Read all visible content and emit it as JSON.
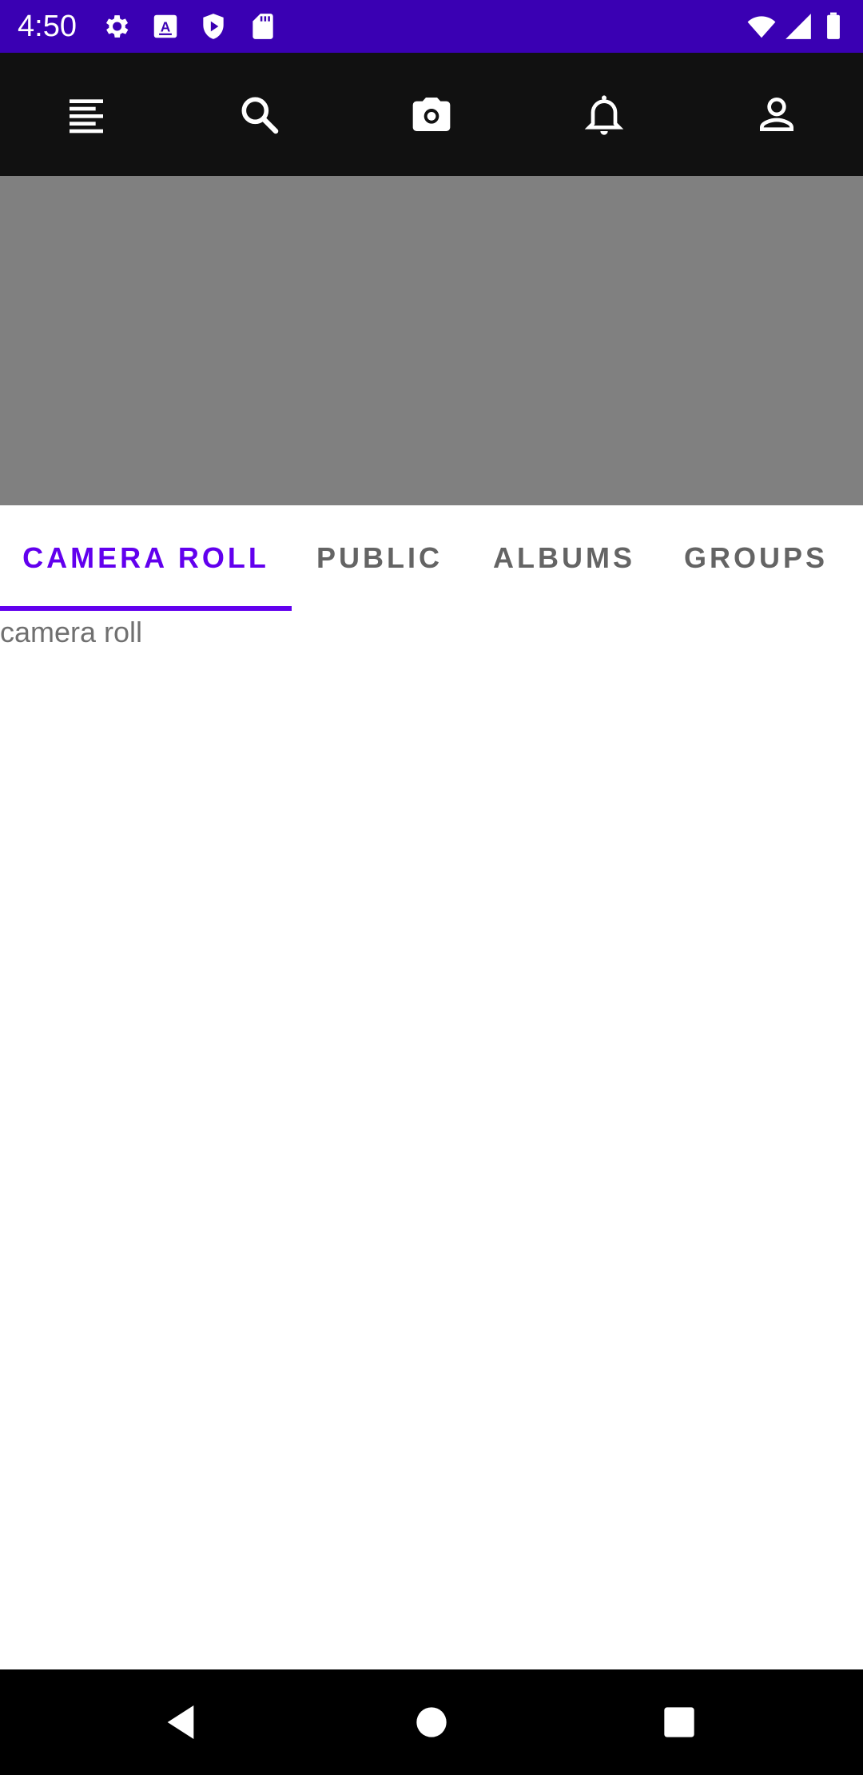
{
  "status_bar": {
    "time": "4:50",
    "left_icons": [
      "settings-icon",
      "keyboard-a-icon",
      "shield-play-icon",
      "sd-card-icon"
    ],
    "right_icons": [
      "wifi-icon",
      "cellular-signal-icon",
      "battery-icon"
    ],
    "background": "#3a00b3"
  },
  "app_bar": {
    "icons": [
      "menu-icon",
      "search-icon",
      "camera-icon",
      "notifications-bell-icon",
      "profile-icon"
    ],
    "background": "#111111"
  },
  "banner": {
    "color": "#808080"
  },
  "tabs": {
    "items": [
      {
        "label": "CAMERA ROLL",
        "active": true
      },
      {
        "label": "PUBLIC",
        "active": false
      },
      {
        "label": "ALBUMS",
        "active": false
      },
      {
        "label": "GROUPS",
        "active": false
      }
    ],
    "accent_color": "#6200ee"
  },
  "content": {
    "text": "camera roll"
  },
  "nav_bar": {
    "icons": [
      "back-icon",
      "home-icon",
      "recents-icon"
    ]
  }
}
